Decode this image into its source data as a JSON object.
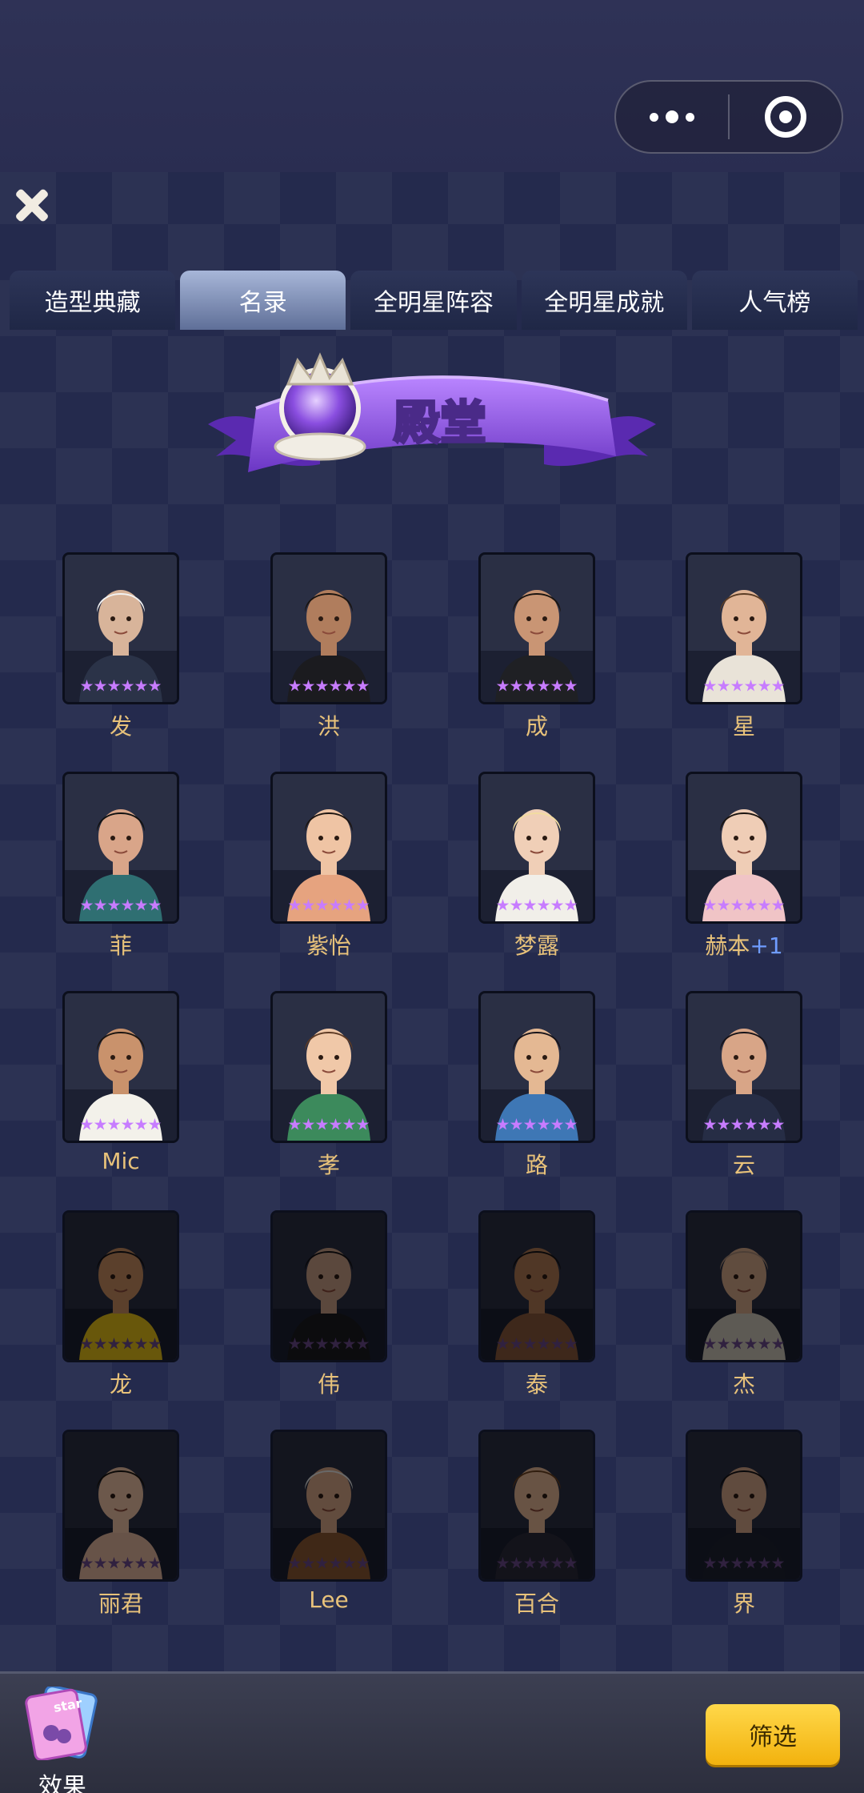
{
  "header": {
    "menu_icon": "more-dots-icon",
    "close_app_icon": "target-circle-icon",
    "close_icon": "close-x-icon"
  },
  "tabs": [
    {
      "label": "造型典藏",
      "active": false
    },
    {
      "label": "名录",
      "active": true
    },
    {
      "label": "全明星阵容",
      "active": false
    },
    {
      "label": "全明星成就",
      "active": false
    },
    {
      "label": "人气榜",
      "active": false
    }
  ],
  "banner": {
    "title": "殿堂",
    "icon": "crown-icon"
  },
  "cards": [
    {
      "name": "发",
      "stars": 6,
      "dim": false,
      "skin": "#d8b49a",
      "hair": "#f2f2f2",
      "outfit": "#2b3348"
    },
    {
      "name": "洪",
      "stars": 6,
      "dim": false,
      "skin": "#b07d5d",
      "hair": "#1a1410",
      "outfit": "#1b1b1f"
    },
    {
      "name": "成",
      "stars": 6,
      "dim": false,
      "skin": "#c99574",
      "hair": "#1a1410",
      "outfit": "#1f2024"
    },
    {
      "name": "星",
      "stars": 6,
      "dim": false,
      "skin": "#e1b597",
      "hair": "#5b3c25",
      "outfit": "#e9e3d8"
    },
    {
      "name": "菲",
      "stars": 6,
      "dim": false,
      "skin": "#d9a589",
      "hair": "#111",
      "outfit": "#2f6f72"
    },
    {
      "name": "紫怡",
      "stars": 6,
      "dim": false,
      "skin": "#efc4a4",
      "hair": "#1d1511",
      "outfit": "#e6a37f"
    },
    {
      "name": "梦露",
      "stars": 6,
      "dim": false,
      "skin": "#f0cfb7",
      "hair": "#f2dca0",
      "outfit": "#f1efe9"
    },
    {
      "name": "赫本",
      "plus": "+1",
      "stars": 6,
      "dim": false,
      "skin": "#efcdb6",
      "hair": "#1a1410",
      "outfit": "#f0c4c6"
    },
    {
      "name": "Mic",
      "stars": 6,
      "dim": false,
      "skin": "#c9926c",
      "hair": "#1a1410",
      "outfit": "#f3f1ea"
    },
    {
      "name": "孝",
      "stars": 6,
      "dim": false,
      "skin": "#f0c8a8",
      "hair": "#5d3a24",
      "outfit": "#3c8a5c"
    },
    {
      "name": "路",
      "stars": 6,
      "dim": false,
      "skin": "#e4b893",
      "hair": "#16131a",
      "outfit": "#3e77b5"
    },
    {
      "name": "云",
      "stars": 6,
      "dim": false,
      "skin": "#d8a587",
      "hair": "#151218",
      "outfit": "#262d45"
    },
    {
      "name": "龙",
      "stars": 6,
      "dim": true,
      "skin": "#c98e63",
      "hair": "#151218",
      "outfit": "#e6c21a"
    },
    {
      "name": "伟",
      "stars": 6,
      "dim": true,
      "skin": "#caa088",
      "hair": "#151218",
      "outfit": "#1b1b1f"
    },
    {
      "name": "泰",
      "stars": 6,
      "dim": true,
      "skin": "#b17a55",
      "hair": "#151218",
      "outfit": "#8b5a3c"
    },
    {
      "name": "杰",
      "stars": 6,
      "dim": true,
      "skin": "#d4a88b",
      "hair": "#a98b78",
      "outfit": "#cfc7bb"
    },
    {
      "name": "丽君",
      "stars": 6,
      "dim": true,
      "skin": "#efc4a6",
      "hair": "#1a1410",
      "outfit": "#e4b8a0"
    },
    {
      "name": "Lee",
      "stars": 6,
      "dim": true,
      "skin": "#d9a98a",
      "hair": "#e8e8e8",
      "outfit": "#8d5a33"
    },
    {
      "name": "百合",
      "stars": 6,
      "dim": true,
      "skin": "#e6b897",
      "hair": "#6a4021",
      "outfit": "#2c2a3a"
    },
    {
      "name": "界",
      "stars": 6,
      "dim": true,
      "skin": "#d6a789",
      "hair": "#151218",
      "outfit": "#1e2232"
    }
  ],
  "bottom": {
    "effect_label": "效果",
    "effect_icon": "star-cards-icon",
    "filter_label": "筛选"
  }
}
